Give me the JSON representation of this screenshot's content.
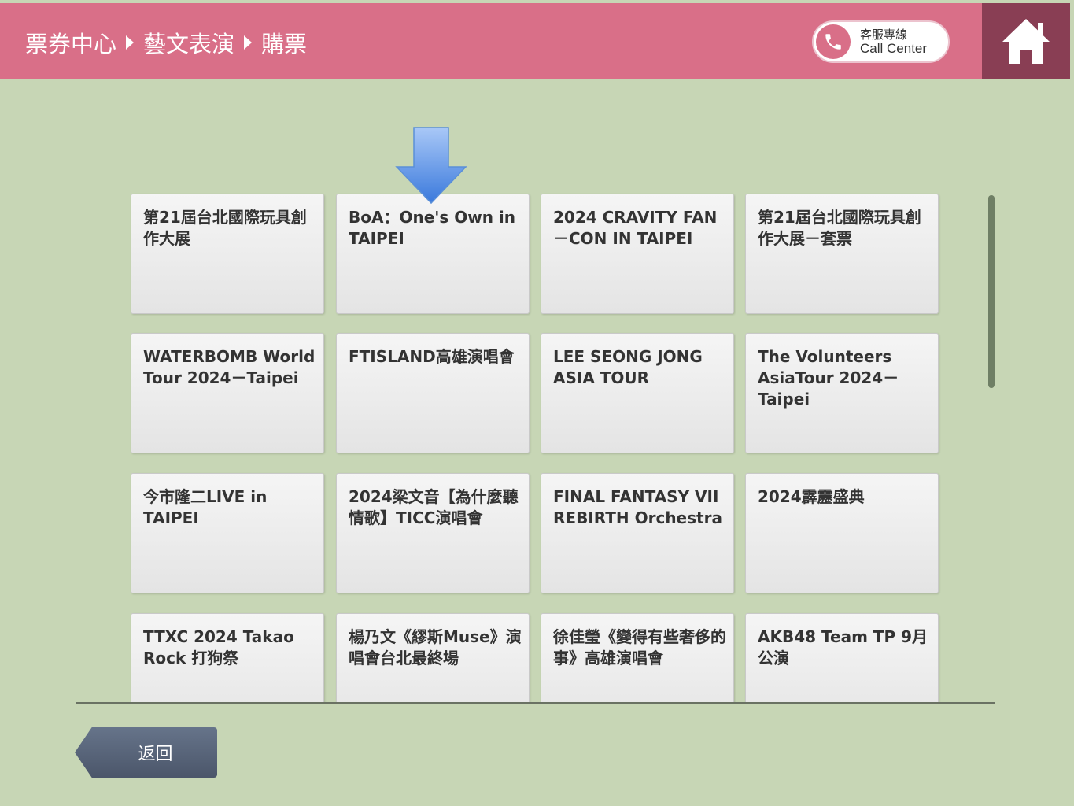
{
  "header": {
    "breadcrumb": [
      "票券中心",
      "藝文表演",
      "購票"
    ],
    "call_center": {
      "zh": "客服專線",
      "en": "Call Center",
      "icon": "phone-icon"
    },
    "home_icon": "home-icon",
    "colors": {
      "bar": "#d96f88",
      "home_bg": "#893e54",
      "page_bg": "#c7d6b5"
    }
  },
  "events": [
    "第21屆台北國際玩具創作大展",
    "BoA：One's Own in TAIPEI",
    "2024 CRAVITY FAN－CON IN TAIPEI",
    "第21屆台北國際玩具創作大展－套票",
    "WATERBOMB World Tour 2024－Taipei",
    "FTISLAND高雄演唱會",
    "LEE SEONG JONG ASIA TOUR",
    "The Volunteers AsiaTour 2024－Taipei",
    "今市隆二LIVE in TAIPEI",
    "2024梁文音【為什麼聽情歌】TICC演唱會",
    "FINAL FANTASY VII REBIRTH Orchestra",
    "2024霹靂盛典",
    "TTXC 2024 Takao Rock 打狗祭",
    "楊乃文《繆斯Muse》演唱會台北最終場",
    "徐佳瑩《變得有些奢侈的事》高雄演唱會",
    "AKB48 Team TP 9月公演"
  ],
  "back_label": "返回"
}
